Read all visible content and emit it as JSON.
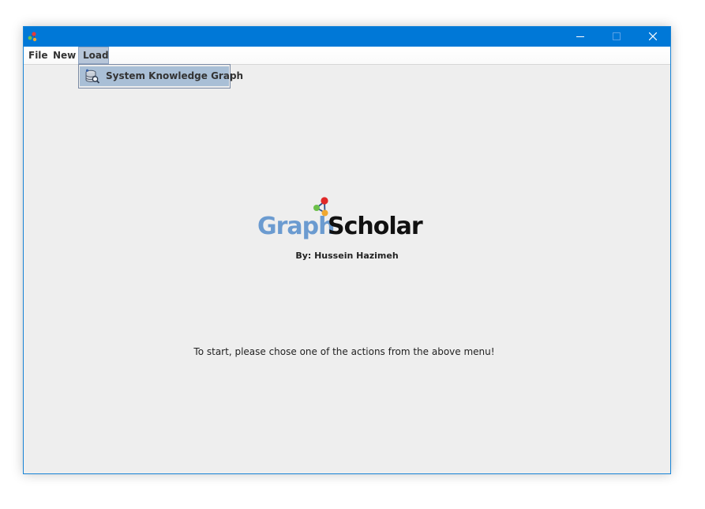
{
  "window": {
    "title": "",
    "accent_color": "#0078d7"
  },
  "menubar": {
    "items": [
      {
        "label": "File"
      },
      {
        "label": "New"
      },
      {
        "label": "Load"
      }
    ]
  },
  "load_menu": {
    "items": [
      {
        "label": "System Knowledge Graph",
        "icon": "database-search-icon"
      }
    ]
  },
  "logo": {
    "part1": "Graph",
    "part2": "Scholar",
    "color_part1": "#6b9bd0",
    "color_part2": "#111111"
  },
  "author": "By: Hussein Hazimeh",
  "instructions": "To start, please chose one of the actions from the above menu!"
}
